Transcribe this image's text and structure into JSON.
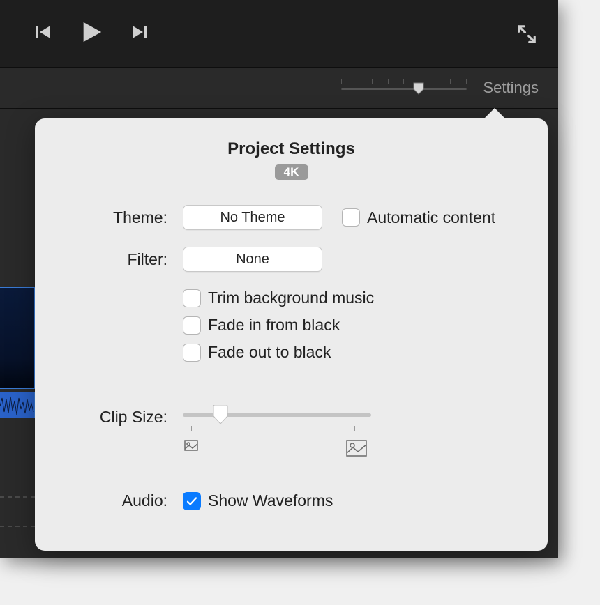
{
  "subbar": {
    "settings_label": "Settings"
  },
  "popover": {
    "title": "Project Settings",
    "badge": "4K",
    "theme": {
      "label": "Theme:",
      "value": "No Theme",
      "automatic_label": "Automatic content",
      "automatic_checked": false
    },
    "filter": {
      "label": "Filter:",
      "value": "None"
    },
    "clip_options": {
      "trim_label": "Trim background music",
      "trim_checked": false,
      "fadein_label": "Fade in from black",
      "fadein_checked": false,
      "fadeout_label": "Fade out to black",
      "fadeout_checked": false
    },
    "clip_size": {
      "label": "Clip Size:"
    },
    "audio": {
      "label": "Audio:",
      "waveforms_label": "Show Waveforms",
      "waveforms_checked": true
    }
  }
}
